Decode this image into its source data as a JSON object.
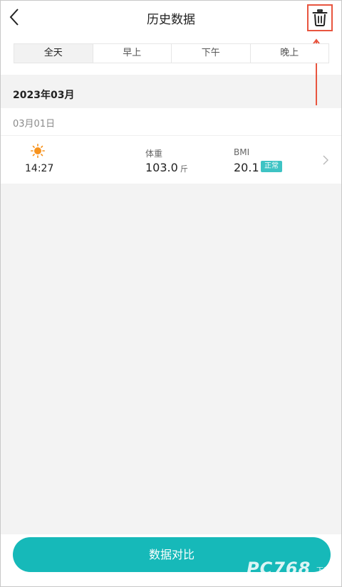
{
  "header": {
    "title": "历史数据",
    "back_icon": "chevron-left-icon",
    "delete_icon": "trash-icon"
  },
  "tabs": [
    {
      "label": "全天",
      "active": true
    },
    {
      "label": "早上",
      "active": false
    },
    {
      "label": "下午",
      "active": false
    },
    {
      "label": "晚上",
      "active": false
    }
  ],
  "history": {
    "month": "2023年03月",
    "days": [
      {
        "date": "03月01日",
        "records": [
          {
            "period_icon": "sun-icon",
            "time": "14:27",
            "weight_label": "体重",
            "weight_value": "103.0",
            "weight_unit": "斤",
            "bmi_label": "BMI",
            "bmi_value": "20.1",
            "bmi_status": "正常"
          }
        ]
      }
    ]
  },
  "footer": {
    "compare_label": "数据对比"
  },
  "watermark": {
    "text": "PC768",
    "sub": "下载"
  },
  "colors": {
    "accent": "#16b9b9",
    "badge": "#3ec3c4",
    "sun": "#f7931e",
    "highlight": "#e8553f"
  }
}
